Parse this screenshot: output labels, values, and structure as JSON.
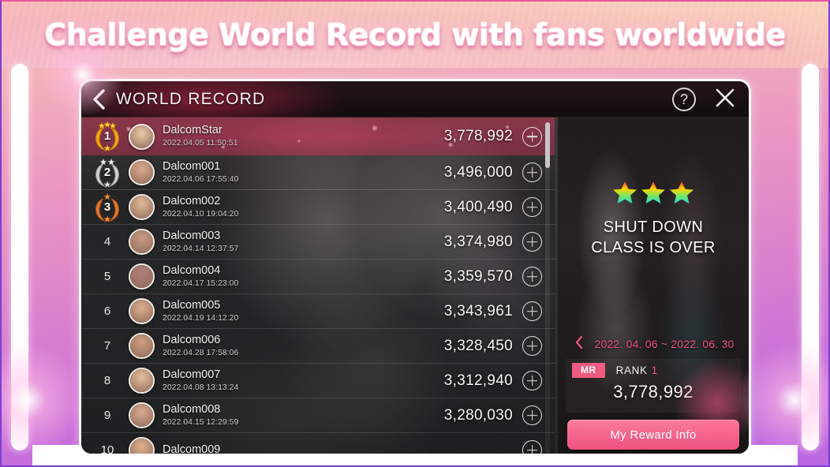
{
  "banner": {
    "headline": "Challenge World Record with fans worldwide"
  },
  "dialog": {
    "title": "WORLD RECORD",
    "back_icon": "chevron-left-icon",
    "help_icon": "question-mark-icon",
    "help_label": "?",
    "close_icon": "close-x-icon"
  },
  "leaderboard": {
    "add_icon": "plus-circle-icon",
    "rows": [
      {
        "rank": "1",
        "medal": "gold",
        "stars": 3,
        "name": "DalcomStar",
        "time": "2022.04.05 11:50:51",
        "score": "3,778,992",
        "avatar": "#e8c9a8"
      },
      {
        "rank": "2",
        "medal": "silver",
        "stars": 2,
        "name": "Dalcom001",
        "time": "2022.04.06 17:55:40",
        "score": "3,496,000",
        "avatar": "#dba98e"
      },
      {
        "rank": "3",
        "medal": "bronze",
        "stars": 1,
        "name": "Dalcom002",
        "time": "2022.04.10 19:04:20",
        "score": "3,400,490",
        "avatar": "#e3bb99"
      },
      {
        "rank": "4",
        "medal": "",
        "stars": 0,
        "name": "Dalcom003",
        "time": "2022.04.14 12:37:57",
        "score": "3,374,980",
        "avatar": "#c99c86"
      },
      {
        "rank": "5",
        "medal": "",
        "stars": 0,
        "name": "Dalcom004",
        "time": "2022.04.17 15:23:00",
        "score": "3,359,570",
        "avatar": "#b07f7c"
      },
      {
        "rank": "6",
        "medal": "",
        "stars": 0,
        "name": "Dalcom005",
        "time": "2022.04.19 14:12:20",
        "score": "3,343,961",
        "avatar": "#dcae91"
      },
      {
        "rank": "7",
        "medal": "",
        "stars": 0,
        "name": "Dalcom006",
        "time": "2022.04.28 17:58:06",
        "score": "3,328,450",
        "avatar": "#cf9f84"
      },
      {
        "rank": "8",
        "medal": "",
        "stars": 0,
        "name": "Dalcom007",
        "time": "2022.04.08 13:13:24",
        "score": "3,312,940",
        "avatar": "#e5bf9c"
      },
      {
        "rank": "9",
        "medal": "",
        "stars": 0,
        "name": "Dalcom008",
        "time": "2022.04.15 12:29:59",
        "score": "3,280,030",
        "avatar": "#d9ab92"
      },
      {
        "rank": "10",
        "medal": "",
        "stars": 0,
        "name": "Dalcom009",
        "time": "",
        "score": "",
        "avatar": "#e0b18e"
      }
    ]
  },
  "sidebar": {
    "star_count": 3,
    "song_line1": "SHUT DOWN",
    "song_line2": "CLASS IS OVER",
    "prev_icon": "chevron-left-icon",
    "period": "2022. 04. 06 ~ 2022. 06. 30",
    "mr_badge": "MR",
    "rank_label": "RANK",
    "rank_value": "1",
    "record_score": "3,778,992",
    "reward_button": "My Reward Info"
  },
  "colors": {
    "accent_pink": "#ef5a82",
    "period_pink": "#f2527e",
    "banner_white": "#ffffff"
  }
}
